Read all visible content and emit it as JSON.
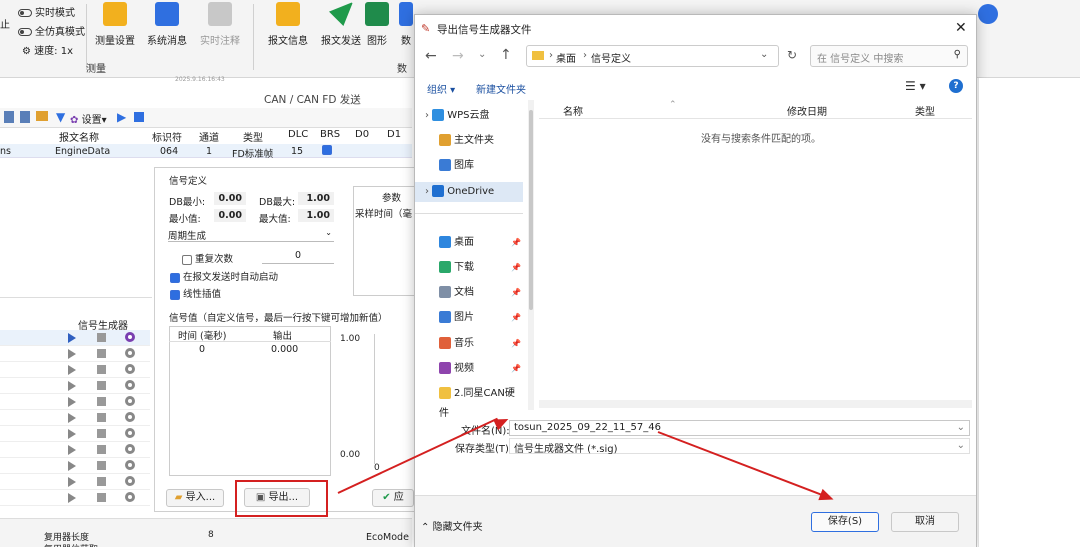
{
  "ribbon": {
    "realtime_mode": "实时模式",
    "full_sim_mode": "全仿真模式",
    "speed": "速度: 1x",
    "left_cut": "止",
    "btn_measure_setup": "测量设置",
    "btn_sys_msg": "系统消息",
    "btn_realtime_note": "实时注释",
    "btn_msg_info": "报文信息",
    "btn_msg_send": "报文发送",
    "btn_graph": "图形",
    "btn_cut": "数",
    "group_measure": "测量",
    "group_cut": "数",
    "small_time": "2025.9.16.16:43"
  },
  "can_window": {
    "title": "CAN / CAN FD 发送",
    "toolbar_settings": "设置",
    "headers": [
      "报文名称",
      "标识符",
      "通道",
      "类型",
      "DLC",
      "BRS",
      "D0",
      "D1"
    ],
    "row": {
      "prefix": "ns",
      "name": "EngineData",
      "id": "064",
      "channel": "1",
      "type": "FD标准帧",
      "dlc": "15"
    }
  },
  "signal_panel": {
    "group_def": "信号定义",
    "db_min_label": "DB最小:",
    "db_min": "0.00",
    "db_max_label": "DB最大:",
    "db_max": "1.00",
    "min_label": "最小值:",
    "min": "0.00",
    "max_label": "最大值:",
    "max": "1.00",
    "mode": "周期生成",
    "repeat_label": "重复次数",
    "repeat_value": "0",
    "auto_start": "在报文发送时自动启动",
    "linear": "线性插值",
    "params_header": "参数",
    "sample_time": "采样时间（毫",
    "values_title": "信号值（自定义信号，最后一行按下键可增加新值）",
    "col_time": "时间 (毫秒)",
    "col_out": "输出",
    "row_time": "0",
    "row_out": "0.000",
    "chart_top": "1.00",
    "chart_bottom": "0.00",
    "chart_x0": "0",
    "import_btn": "导入...",
    "export_btn": "导出...",
    "ok_cut": "应"
  },
  "left_list": {
    "header": "信号生成器",
    "bottom1": "复用器长度",
    "bottom1_val": "8",
    "bottom2": "复用器位获取",
    "ecomode": "EcoMode"
  },
  "dialog": {
    "title": "导出信号生成器文件",
    "breadcrumb": [
      "桌面",
      "信号定义"
    ],
    "search_placeholder": "在 信号定义 中搜索",
    "organize": "组织",
    "new_folder": "新建文件夹",
    "nav": [
      {
        "label": "WPS云盘",
        "icon": "#2f8fe0"
      },
      {
        "label": "主文件夹",
        "icon": "#e0a030"
      },
      {
        "label": "图库",
        "icon": "#3a7bd5"
      },
      {
        "label": "OneDrive",
        "icon": "#1f6fd0"
      },
      {
        "label": "桌面",
        "icon": "#2e86de"
      },
      {
        "label": "下载",
        "icon": "#2aa86a"
      },
      {
        "label": "文档",
        "icon": "#7f8fa6"
      },
      {
        "label": "图片",
        "icon": "#3a7bd5"
      },
      {
        "label": "音乐",
        "icon": "#e0603a"
      },
      {
        "label": "视频",
        "icon": "#8e44ad"
      },
      {
        "label": "2.同星CAN硬件",
        "icon": "#f0c040"
      }
    ],
    "col_name": "名称",
    "col_date": "修改日期",
    "col_type": "类型",
    "empty_msg": "没有与搜索条件匹配的项。",
    "filename_label": "文件名(N):",
    "filename": "tosun_2025_09_22_11_57_46",
    "filetype_label": "保存类型(T):",
    "filetype": "信号生成器文件 (*.sig)",
    "hide_folders": "隐藏文件夹",
    "save": "保存(S)",
    "cancel": "取消"
  },
  "colors": {
    "accent": "#2e6ee0",
    "arrow": "#d42020"
  }
}
